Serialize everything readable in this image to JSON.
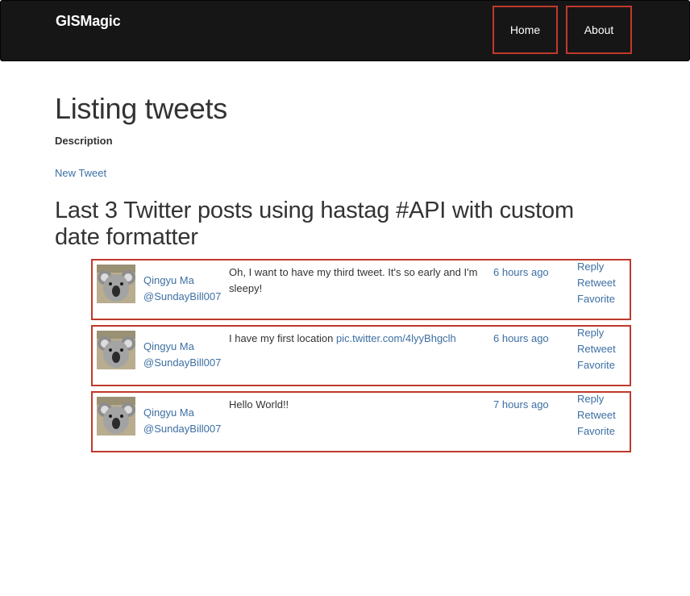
{
  "navbar": {
    "brand": "GISMagic",
    "links": [
      {
        "label": "Home"
      },
      {
        "label": "About"
      }
    ]
  },
  "page": {
    "title": "Listing tweets",
    "description_label": "Description",
    "new_tweet_link": "New Tweet",
    "section_title": "Last 3 Twitter posts using hastag #API with custom date formatter"
  },
  "tweets": [
    {
      "name": "Qingyu Ma",
      "handle": "@SundayBill007",
      "text": "Oh, I want to have my third tweet. It's so early and I'm sleepy!",
      "link": "",
      "time": "6 hours ago",
      "actions": [
        "Reply",
        "Retweet",
        "Favorite"
      ]
    },
    {
      "name": "Qingyu Ma",
      "handle": "@SundayBill007",
      "text": "I have my first location ",
      "link": "pic.twitter.com/4lyyBhgclh",
      "time": "6 hours ago",
      "actions": [
        "Reply",
        "Retweet",
        "Favorite"
      ]
    },
    {
      "name": "Qingyu Ma",
      "handle": "@SundayBill007",
      "text": "Hello World!!",
      "link": "",
      "time": "7 hours ago",
      "actions": [
        "Reply",
        "Retweet",
        "Favorite"
      ]
    }
  ],
  "icons": {
    "avatar": "koala-avatar-image"
  },
  "colors": {
    "navbar_bg": "#161616",
    "highlight_border": "#c0392b",
    "link": "#3d6fa3"
  }
}
